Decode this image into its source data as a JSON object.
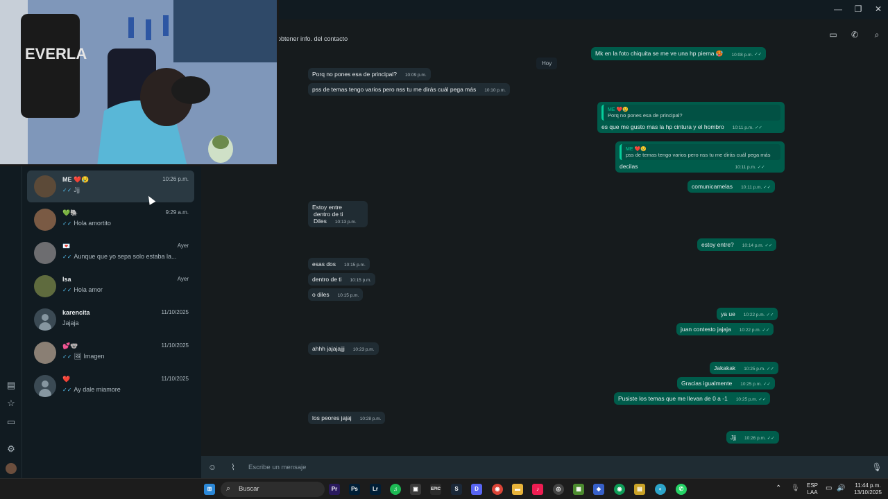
{
  "window": {
    "minimize": "—",
    "maximize": "❐",
    "close": "✕"
  },
  "header": {
    "subtitle": "obtener info. del contacto"
  },
  "rail": {
    "icons": [
      "chat-status-icon",
      "star-icon",
      "archive-icon",
      "settings-icon"
    ]
  },
  "chats": [
    {
      "name": "ME ❤️😢",
      "time": "10:26 p.m.",
      "preview": "Jjj",
      "ticks": true,
      "active": true,
      "avatar": "#5c4a38"
    },
    {
      "name": "💚🐘",
      "time": "9:29 a.m.",
      "preview": "Hola amortito",
      "ticks": true,
      "active": false,
      "avatar": "#7a5a44"
    },
    {
      "name": "💌",
      "time": "Ayer",
      "preview": "Aunque que yo sepa solo estaba la...",
      "ticks": true,
      "active": false,
      "avatar": "#6d6d70"
    },
    {
      "name": "Isa",
      "time": "Ayer",
      "preview": "Hola amor",
      "ticks": true,
      "active": false,
      "avatar": "#5f6b3e"
    },
    {
      "name": "karencita",
      "time": "11/10/2025",
      "preview": "Jajaja",
      "ticks": false,
      "active": false,
      "avatar": "placeholder"
    },
    {
      "name": "💕🐨",
      "time": "11/10/2025",
      "preview": "🖼 Imagen",
      "ticks": true,
      "active": false,
      "avatar": "#8a7f74"
    },
    {
      "name": "❤️",
      "time": "11/10/2025",
      "preview": "Ay dale miamore",
      "ticks": true,
      "active": false,
      "avatar": "placeholder"
    }
  ],
  "date_chip": "Hoy",
  "messages": {
    "m1": {
      "text": "Mk en la foto chiquita se me ve una hp pierna 🥵",
      "time": "10:08 p.m."
    },
    "m2": {
      "text": "Porq no pones esa de principal?",
      "time": "10:09 p.m."
    },
    "m3": {
      "text": "pss de temas tengo varios pero nss tu me dirás cuál pega más",
      "time": "10:10 p.m."
    },
    "m4": {
      "quote_name": "ME ❤️😢",
      "quote_text": "Porq no pones esa de principal?",
      "text": "es que me gusto mas la hp cintura y el hombro",
      "time": "10:11 p.m."
    },
    "m5": {
      "quote_name": "ME ❤️😢",
      "quote_text": "pss de temas tengo varios pero nss tu me dirás cuál pega más",
      "text": "decilas",
      "time": "10:11 p.m."
    },
    "m6": {
      "text": "comunicamelas",
      "time": "10:11 p.m."
    },
    "m7": {
      "line1": "Estoy entre",
      "line2": "dentro de ti",
      "line3": "Diles",
      "time": "10:13 p.m."
    },
    "m8": {
      "text": "estoy entre?",
      "time": "10:14 p.m."
    },
    "m9": {
      "text": "esas dos",
      "time": "10:15 p.m."
    },
    "m10": {
      "text": "dentro de ti",
      "time": "10:15 p.m."
    },
    "m11": {
      "text": "o diles",
      "time": "10:15 p.m."
    },
    "m12": {
      "text": "ya ue",
      "time": "10:22 p.m."
    },
    "m13": {
      "text": "juan contesto jajaja",
      "time": "10:22 p.m."
    },
    "m14": {
      "text": "ahhh jajajajjj",
      "time": "10:23 p.m."
    },
    "m15": {
      "text": "Jakakak",
      "time": "10:25 p.m."
    },
    "m16": {
      "text": "Gracias igualmente",
      "time": "10:25 p.m."
    },
    "m17": {
      "text": "Pusiste los temas que me llevan de 0 a -1",
      "time": "10:25 p.m."
    },
    "m18": {
      "text": "los peores jajaj",
      "time": "10:28 p.m."
    },
    "m19": {
      "text": "Jjj",
      "time": "10:26 p.m."
    }
  },
  "composer": {
    "placeholder": "Escribe un mensaje"
  },
  "webcam": {
    "bag_text": "EVERLA"
  },
  "taskbar": {
    "search_label": "Buscar",
    "lang_line1": "ESP",
    "lang_line2": "LAA",
    "clock_time": "11:44 p.m.",
    "clock_date": "13/10/2025",
    "icons": [
      {
        "name": "premiere-icon",
        "label": "Pr",
        "color": "#2a1a5e"
      },
      {
        "name": "photoshop-icon",
        "label": "Ps",
        "color": "#001e36"
      },
      {
        "name": "lightroom-icon",
        "label": "Lr",
        "color": "#001e36"
      },
      {
        "name": "spotify-icon",
        "label": "♫",
        "color": "#1db954"
      },
      {
        "name": "app-icon",
        "label": "▣",
        "color": "#3a3a3a"
      },
      {
        "name": "epic-games-icon",
        "label": "EPIC",
        "color": "#2b2b2b"
      },
      {
        "name": "steam-icon",
        "label": "S",
        "color": "#1b2838"
      },
      {
        "name": "discord-icon",
        "label": "D",
        "color": "#5865f2"
      },
      {
        "name": "chrome-icon",
        "label": "◉",
        "color": "#db4437"
      },
      {
        "name": "file-explorer-icon",
        "label": "▬",
        "color": "#e8b33a"
      },
      {
        "name": "tiktok-icon",
        "label": "♪",
        "color": "#ee1d52"
      },
      {
        "name": "app2-icon",
        "label": "◎",
        "color": "#444"
      },
      {
        "name": "minecraft-icon",
        "label": "▦",
        "color": "#4c8b2f"
      },
      {
        "name": "app3-icon",
        "label": "◆",
        "color": "#3760c9"
      },
      {
        "name": "chrome2-icon",
        "label": "◉",
        "color": "#0f9d58"
      },
      {
        "name": "app4-icon",
        "label": "▤",
        "color": "#c9a227"
      },
      {
        "name": "app5-icon",
        "label": "◐",
        "color": "#2ca4c9"
      },
      {
        "name": "whatsapp-icon",
        "label": "✆",
        "color": "#25d366"
      }
    ]
  }
}
